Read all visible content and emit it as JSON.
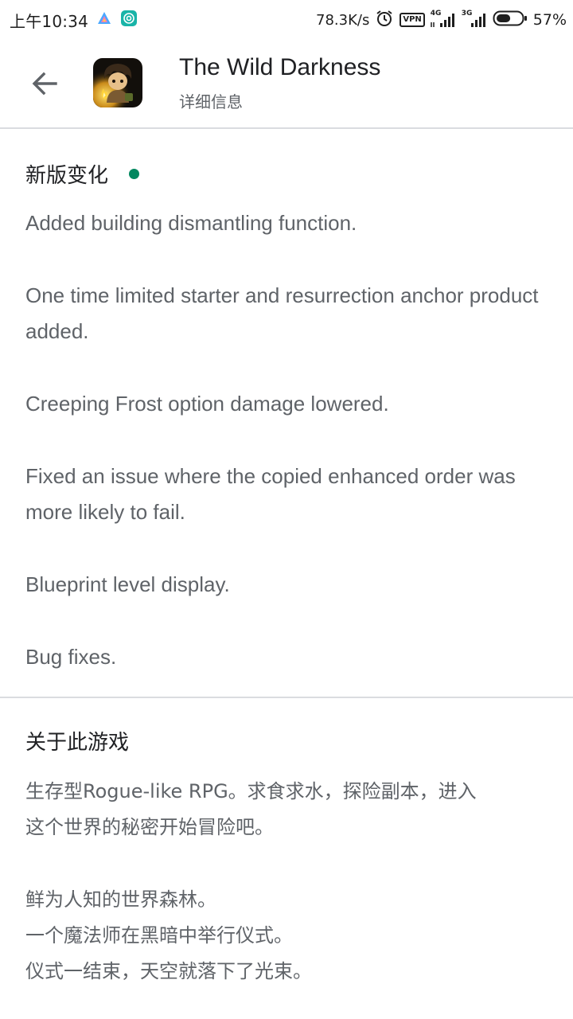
{
  "status_bar": {
    "time": "上午10:34",
    "speed": "78.3K/s",
    "vpn": "VPN",
    "sim1_gen": "4G",
    "sim2_gen": "3G",
    "battery": "57%",
    "battery_level": 0.57
  },
  "header": {
    "app_title": "The Wild Darkness",
    "subtitle": "详细信息"
  },
  "whats_new": {
    "heading": "新版变化",
    "dot_color": "#01875f",
    "items": [
      "Added building dismantling function.",
      "One time limited starter and resurrection anchor product added.",
      "Creeping Frost option damage lowered.",
      "Fixed an issue where the copied enhanced order was more likely to fail.",
      "Blueprint level display.",
      "Bug fixes."
    ]
  },
  "about": {
    "heading": "关于此游戏",
    "paragraph1_line1": "生存型Rogue-like RPG。求食求水，探险副本，进入",
    "paragraph1_line2": "这个世界的秘密开始冒险吧。",
    "paragraph2_lines": [
      "鲜为人知的世界森林。",
      "一个魔法师在黑暗中举行仪式。",
      "仪式一结束，天空就落下了光束。"
    ]
  }
}
